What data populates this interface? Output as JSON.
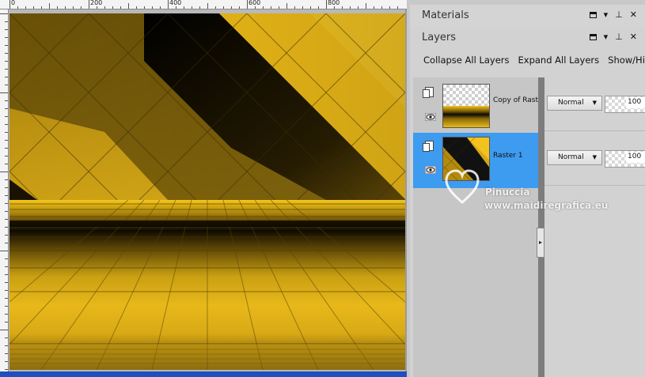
{
  "ruler": {
    "labels": [
      "0",
      "200",
      "400",
      "600",
      "800"
    ]
  },
  "materials": {
    "title": "Materials"
  },
  "layers_panel": {
    "title": "Layers",
    "toolbar": [
      "Collapse All Layers",
      "Expand All Layers",
      "Show/Hide Q"
    ],
    "layers": [
      {
        "name": "Copy of Raster",
        "blend_mode": "Normal",
        "opacity": "100",
        "selected": false
      },
      {
        "name": "Raster 1",
        "blend_mode": "Normal",
        "opacity": "100",
        "selected": true
      }
    ]
  },
  "watermark": {
    "line1": "Pinuccia",
    "line2": "www.maidiregrafica.eu"
  },
  "colors": {
    "gold": "#e8b71a",
    "selection": "#3d9bf0",
    "bottom_bar": "#1f4fbf"
  },
  "icons": [
    "page-icon",
    "eye-icon",
    "pin-icon",
    "close-icon",
    "window-icon",
    "chevron-down-icon"
  ]
}
